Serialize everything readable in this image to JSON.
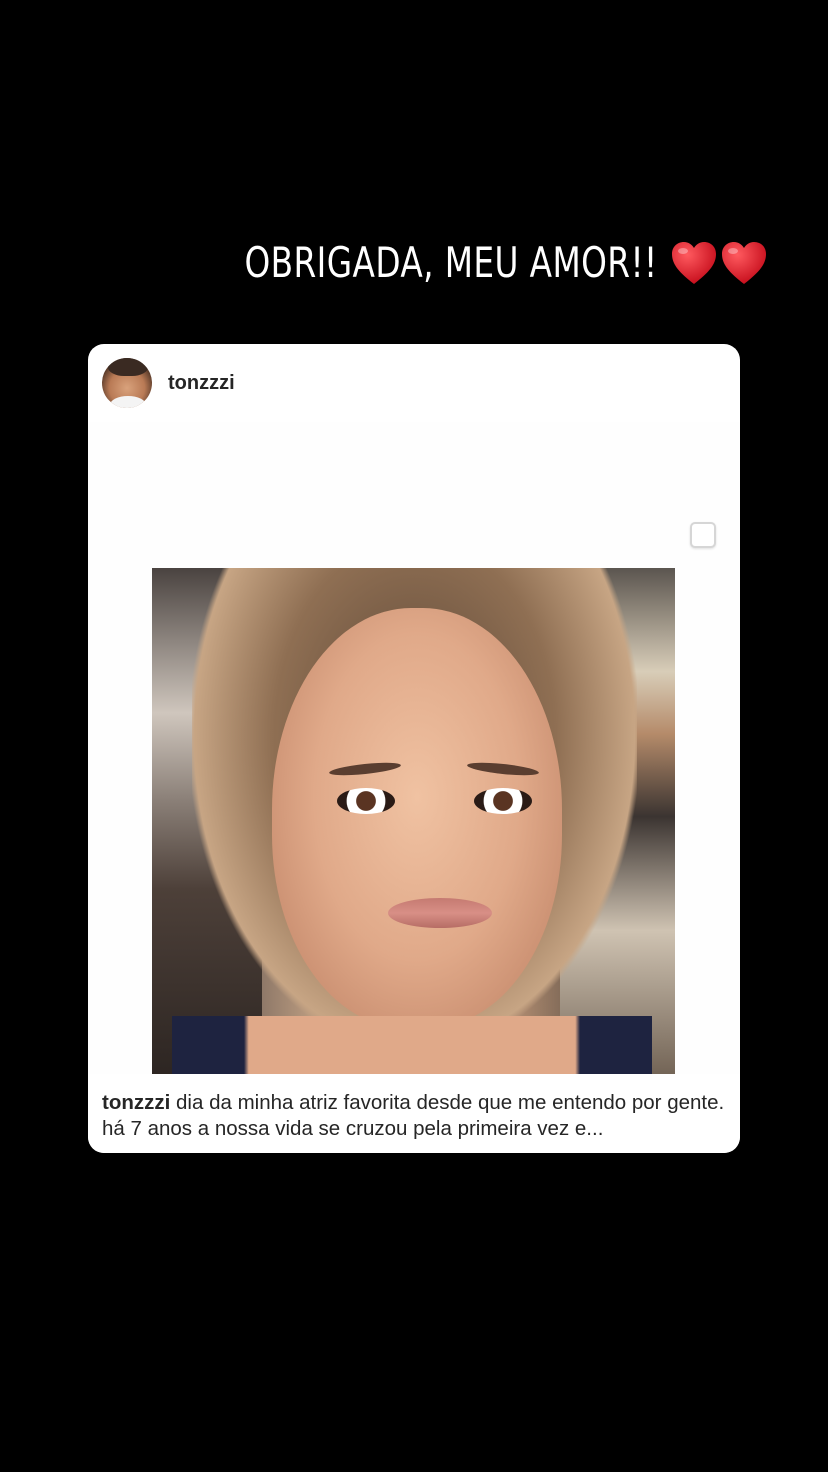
{
  "story": {
    "caption_text": "OBRIGADA, MEU AMOR!!",
    "heart_color": "#e0132a"
  },
  "post": {
    "username": "tonzzzi",
    "caption": {
      "username": "tonzzzi",
      "text": "dia da minha atriz favorita desde que me entendo por gente. há 7 anos a nossa vida se cruzou pela primeira vez e..."
    }
  }
}
